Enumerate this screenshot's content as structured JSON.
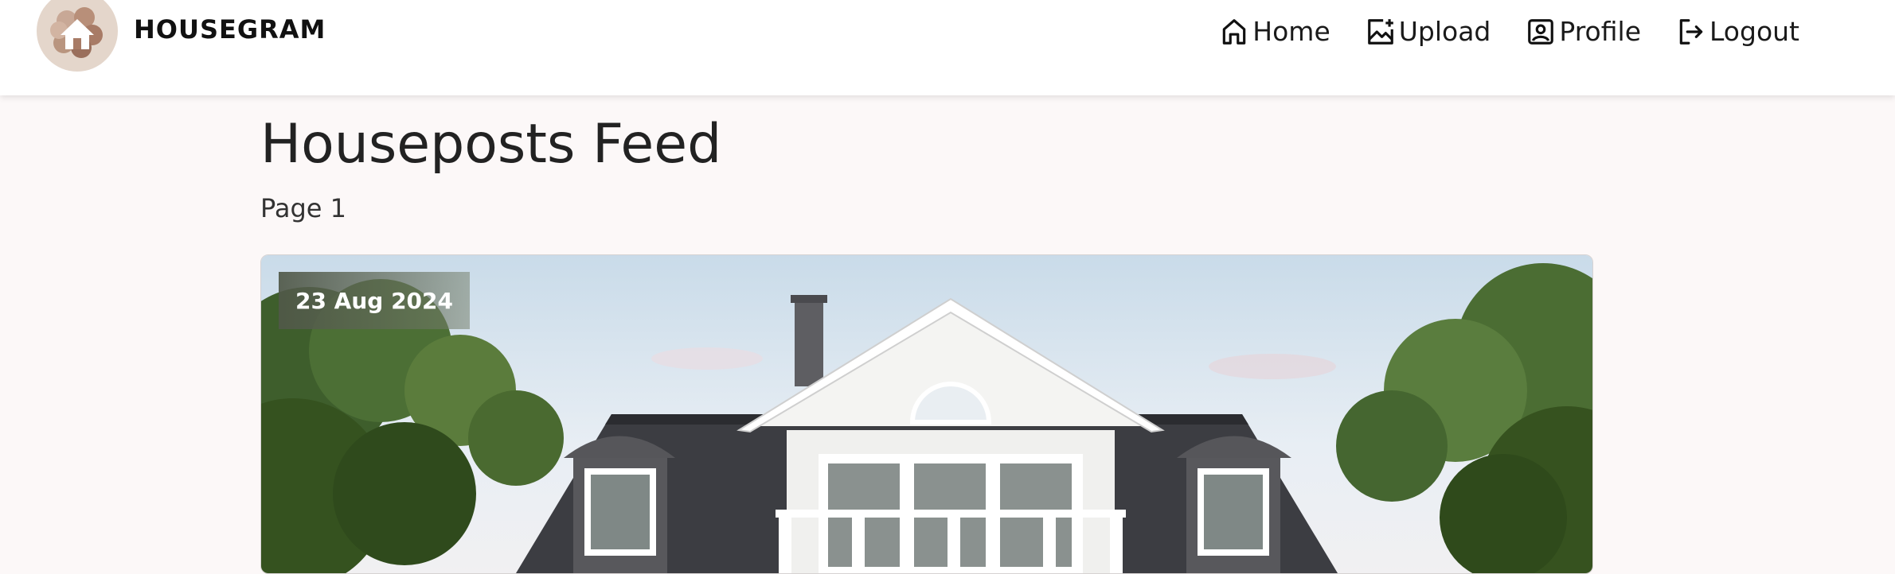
{
  "brand": {
    "name": "HOUSEGRAM",
    "logo_icon": "house-icon"
  },
  "nav": {
    "items": [
      {
        "label": "Home",
        "icon": "home-icon"
      },
      {
        "label": "Upload",
        "icon": "image-plus-icon"
      },
      {
        "label": "Profile",
        "icon": "user-badge-icon"
      },
      {
        "label": "Logout",
        "icon": "logout-icon"
      }
    ]
  },
  "main": {
    "title": "Houseposts Feed",
    "page_label": "Page 1",
    "posts": [
      {
        "date": "23 Aug 2024"
      }
    ]
  },
  "colors": {
    "background": "#fcf8f8",
    "navbar": "#ffffff",
    "logo_bg": "#e4d6cb",
    "badge": "#5f6a55"
  }
}
